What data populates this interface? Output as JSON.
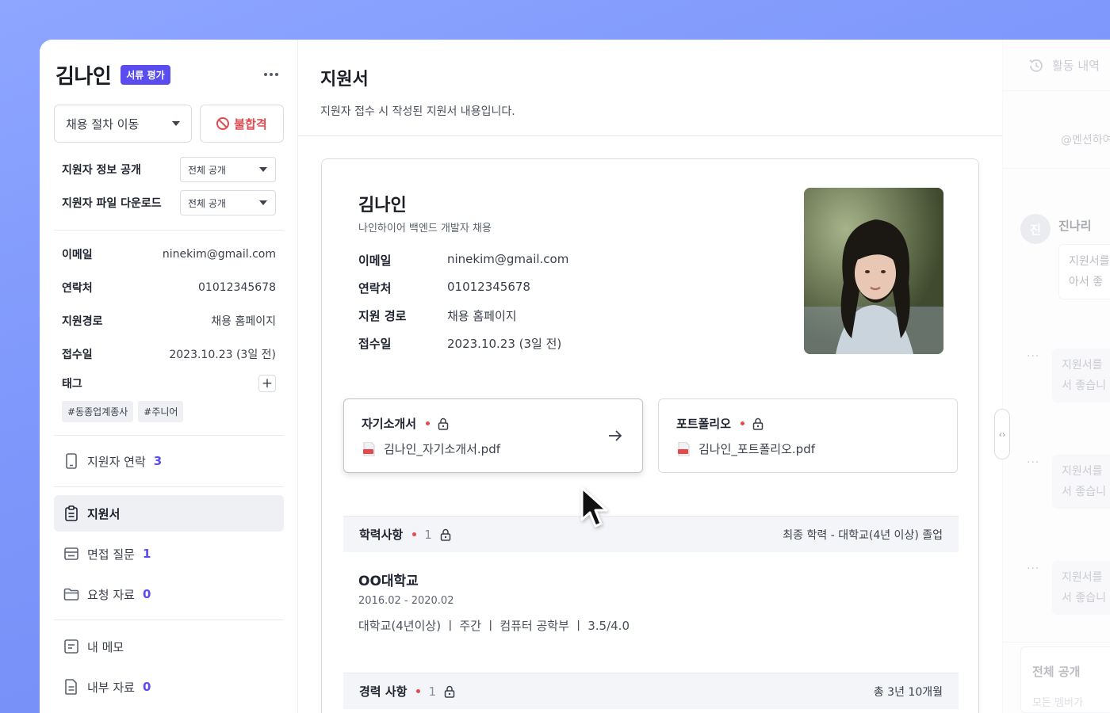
{
  "candidate": {
    "name": "김나인",
    "stage_badge": "서류 평가",
    "job": "나인하이어 백엔드 개발자 채용"
  },
  "sidebar": {
    "move_stage_label": "채용 절차 이동",
    "reject_label": "불합격",
    "options": [
      {
        "label": "지원자 정보 공개",
        "value": "전체 공개"
      },
      {
        "label": "지원자 파일 다운로드",
        "value": "전체 공개"
      }
    ],
    "info": [
      {
        "key": "이메일",
        "value": "ninekim@gmail.com"
      },
      {
        "key": "연락처",
        "value": "01012345678"
      },
      {
        "key": "지원경로",
        "value": "채용 홈페이지"
      },
      {
        "key": "접수일",
        "value": "2023.10.23 (3일 전)"
      }
    ],
    "tags_label": "태그",
    "tags": [
      "#동종업계종사",
      "#주니어"
    ],
    "nav": [
      {
        "label": "지원자 연락",
        "count": "3",
        "icon": "phone-icon"
      },
      {
        "label": "지원서",
        "count": "",
        "icon": "clipboard-icon",
        "active": true
      },
      {
        "label": "면접 질문",
        "count": "1",
        "icon": "card-icon"
      },
      {
        "label": "요청 자료",
        "count": "0",
        "icon": "folder-icon"
      },
      {
        "label": "내 메모",
        "count": "",
        "icon": "memo-icon"
      },
      {
        "label": "내부 자료",
        "count": "0",
        "icon": "document-icon"
      }
    ]
  },
  "main": {
    "title": "지원서",
    "subtitle": "지원자 접수 시 작성된 지원서 내용입니다.",
    "fields": [
      {
        "key": "이메일",
        "value": "ninekim@gmail.com"
      },
      {
        "key": "연락처",
        "value": "01012345678"
      },
      {
        "key": "지원 경로",
        "value": "채용 홈페이지"
      },
      {
        "key": "접수일",
        "value": "2023.10.23 (3일 전)"
      }
    ],
    "files": [
      {
        "title": "자기소개서",
        "filename": "김나인_자기소개서.pdf"
      },
      {
        "title": "포트폴리오",
        "filename": "김나인_포트폴리오.pdf"
      }
    ],
    "education": {
      "title": "학력사항",
      "count": "1",
      "summary": "최종 학력 - 대학교(4년 이상) 졸업",
      "school": "OO대학교",
      "period": "2016.02 - 2020.02",
      "detail": "대학교(4년이상) ㅣ 주간 ㅣ 컴퓨터 공학부 ㅣ 3.5/4.0"
    },
    "career": {
      "title": "경력 사항",
      "count": "1",
      "summary": "총 3년 10개월"
    }
  },
  "right_panel": {
    "activity_label": "활동 내역",
    "mention_placeholder": "@멘션하여",
    "avatar_initial": "진",
    "user": "진나리",
    "bubble_1": [
      "지원서를",
      "아서 좋"
    ],
    "bubble_2": [
      "지원서를",
      "서 좋습니"
    ],
    "bubble_3": [
      "지원서를",
      "서 좋습니"
    ],
    "bubble_4": [
      "지원서를",
      "서 좋습니"
    ],
    "dots": "···",
    "visibility": "전체 공개",
    "visibility_sub": "모든 멤버가"
  },
  "colors": {
    "accent": "#5b4cf0",
    "danger": "#e5484d",
    "background_gradient": "#7d97fb"
  }
}
